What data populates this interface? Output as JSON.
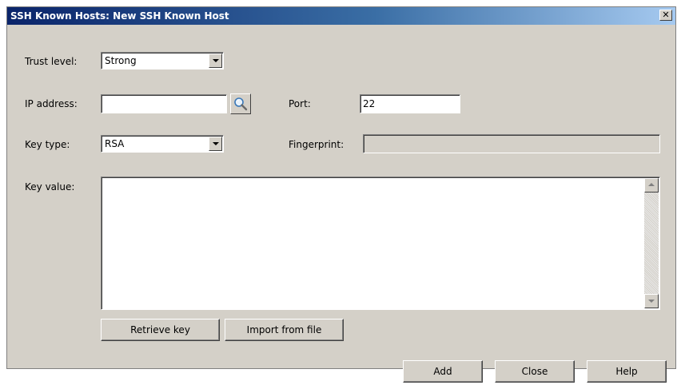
{
  "window": {
    "title": "SSH Known Hosts: New SSH Known Host",
    "close_glyph": "✕"
  },
  "form": {
    "trust_level": {
      "label": "Trust level:",
      "value": "Strong"
    },
    "ip_address": {
      "label": "IP address:",
      "value": "",
      "lookup_icon": "magnifier-icon"
    },
    "port": {
      "label": "Port:",
      "value": "22"
    },
    "key_type": {
      "label": "Key type:",
      "value": "RSA"
    },
    "fingerprint": {
      "label": "Fingerprint:",
      "value": ""
    },
    "key_value": {
      "label": "Key value:",
      "value": ""
    }
  },
  "buttons": {
    "retrieve_key": "Retrieve key",
    "import_from_file": "Import from file",
    "add": "Add",
    "close": "Close",
    "help": "Help"
  },
  "colors": {
    "dialog_bg": "#d4d0c8",
    "titlebar_start": "#0a246a",
    "titlebar_end": "#a6caf0"
  }
}
